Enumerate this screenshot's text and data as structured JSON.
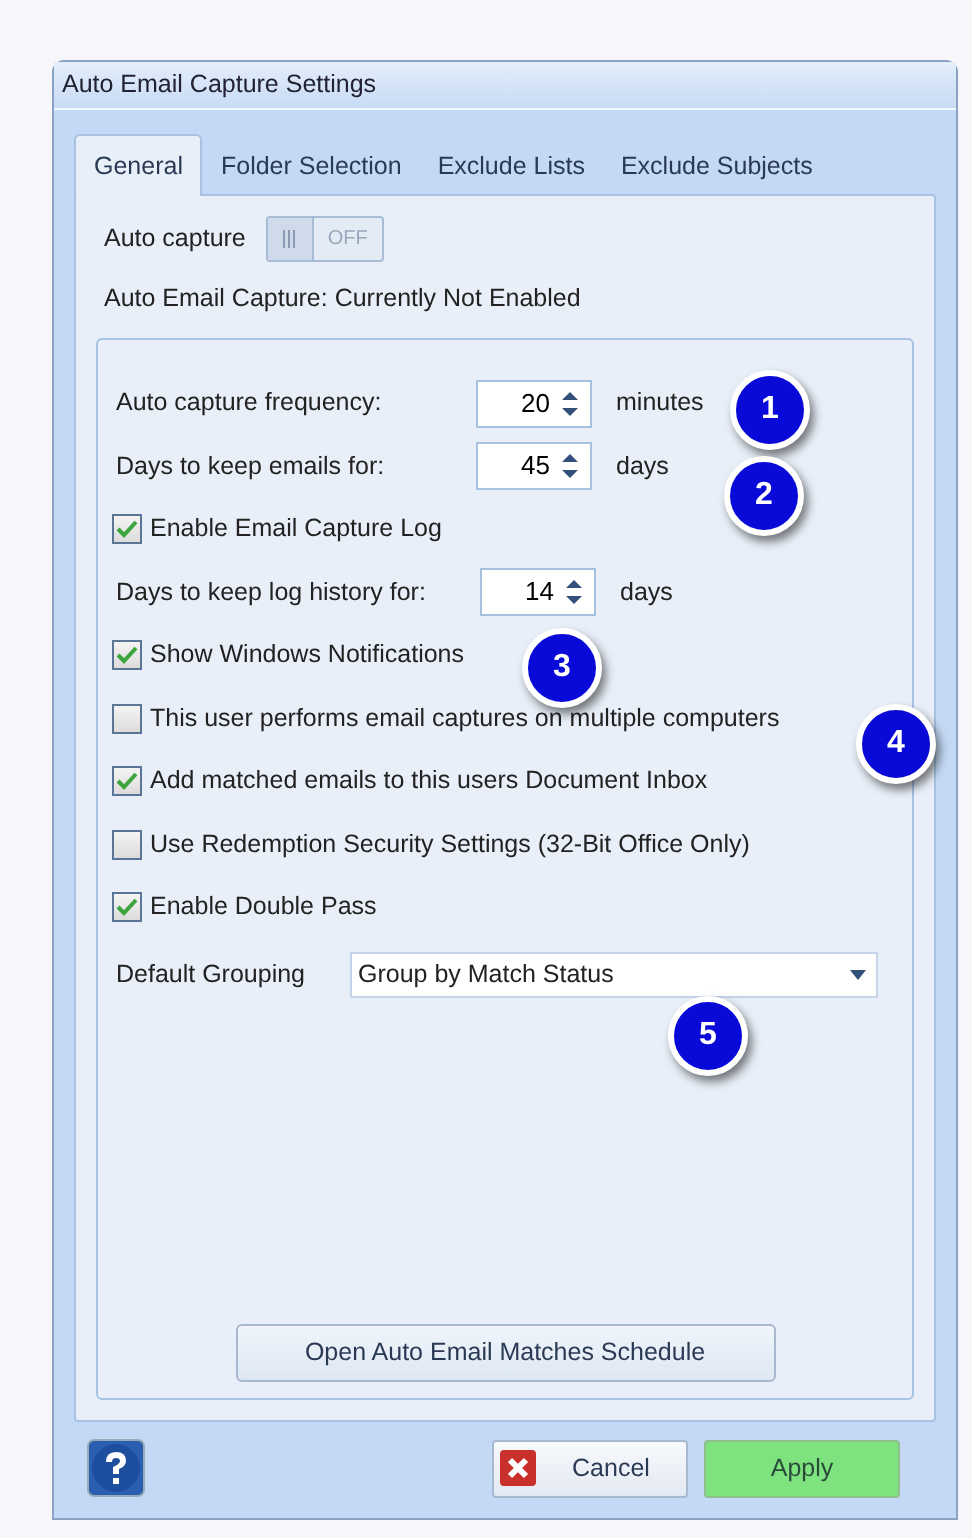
{
  "window": {
    "title": "Auto Email Capture Settings"
  },
  "tabs": [
    {
      "label": "General",
      "selected": true
    },
    {
      "label": "Folder Selection",
      "selected": false
    },
    {
      "label": "Exclude Lists",
      "selected": false
    },
    {
      "label": "Exclude Subjects",
      "selected": false
    }
  ],
  "auto_capture": {
    "label": "Auto capture",
    "on": false,
    "switch_text": "OFF"
  },
  "status": "Auto Email Capture: Currently Not Enabled",
  "settings": [
    {
      "kind": "spinner",
      "label": "Auto capture frequency:",
      "value": "20",
      "unit": "minutes"
    },
    {
      "kind": "spinner",
      "label": "Days to keep emails for:",
      "value": "45",
      "unit": "days"
    },
    {
      "kind": "checkbox",
      "label": "Enable Email Capture Log",
      "checked": true
    },
    {
      "kind": "spinner",
      "label": "Days to keep log history for:",
      "value": "14",
      "unit": "days"
    },
    {
      "kind": "checkbox",
      "label": "Show Windows Notifications",
      "checked": true
    },
    {
      "kind": "checkbox",
      "label": "This user performs email captures on multiple computers",
      "checked": false
    },
    {
      "kind": "checkbox",
      "label": "Add matched emails to this users Document Inbox",
      "checked": true
    },
    {
      "kind": "checkbox",
      "label": "Use Redemption Security Settings (32-Bit Office Only)",
      "checked": false
    },
    {
      "kind": "checkbox",
      "label": "Enable Double Pass",
      "checked": true
    },
    {
      "kind": "dropdown",
      "label": "Default Grouping",
      "value": "Group by Match Status"
    }
  ],
  "schedule_button": "Open Auto Email Matches Schedule",
  "footer_buttons": [
    {
      "label": "Cancel",
      "kind": "cancel"
    },
    {
      "label": "Apply",
      "kind": "apply"
    }
  ],
  "callouts": [
    "1",
    "2",
    "3",
    "4",
    "5"
  ]
}
